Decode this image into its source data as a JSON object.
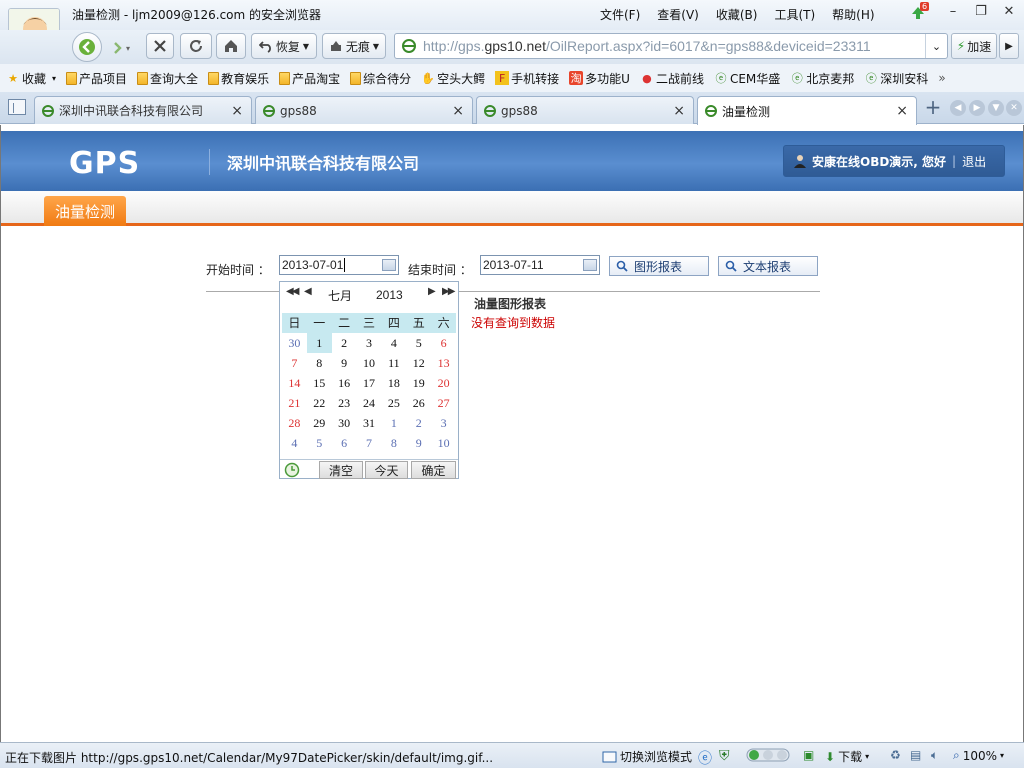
{
  "window": {
    "title": "油量检测 - ljm2009@126.com 的安全浏览器",
    "menus": [
      "文件(F)",
      "查看(V)",
      "收藏(B)",
      "工具(T)",
      "帮助(H)"
    ],
    "update_badge": "6"
  },
  "toolbar": {
    "restore_label": "恢复",
    "notrace_label": "无痕",
    "address_host": "http://gps.",
    "address_domain": "gps10.net",
    "address_path": "/OilReport.aspx?id=6017&n=gps88&deviceid=23311",
    "speedup_label": "加速"
  },
  "bookmarks": {
    "items": [
      "收藏",
      "产品项目",
      "查询大全",
      "教育娱乐",
      "产品淘宝",
      "综合待分",
      "空头大鳄",
      "手机转接",
      "多功能U",
      "二战前线",
      "CEM华盛",
      "北京麦邦",
      "深圳安科"
    ],
    "more": "»"
  },
  "tabs": [
    {
      "label": "深圳中讯联合科技有限公司"
    },
    {
      "label": "gps88"
    },
    {
      "label": "gps88"
    },
    {
      "label": "油量检测"
    }
  ],
  "site": {
    "logo": "GPS",
    "company": "深圳中讯联合科技有限公司",
    "user_greeting": "安康在线OBD演示, 您好",
    "logout": "退出",
    "nav_tab": "油量检测"
  },
  "form": {
    "start_label": "开始时间 ：",
    "start_value": "2013-07-01",
    "end_label": "结束时间 ：",
    "end_value": "2013-07-11",
    "graph_btn": "图形报表",
    "text_btn": "文本报表"
  },
  "report": {
    "title": "油量图形报表",
    "no_data": "没有查询到数据"
  },
  "datepicker": {
    "month": "七月",
    "year": "2013",
    "weekdays": [
      "日",
      "一",
      "二",
      "三",
      "四",
      "五",
      "六"
    ],
    "days": [
      "30",
      "1",
      "2",
      "3",
      "4",
      "5",
      "6",
      "7",
      "8",
      "9",
      "10",
      "11",
      "12",
      "13",
      "14",
      "15",
      "16",
      "17",
      "18",
      "19",
      "20",
      "21",
      "22",
      "23",
      "24",
      "25",
      "26",
      "27",
      "28",
      "29",
      "30",
      "31",
      "1",
      "2",
      "3",
      "4",
      "5",
      "6",
      "7",
      "8",
      "9",
      "10"
    ],
    "other_month_indices": [
      0,
      32,
      33,
      34,
      35,
      36,
      37,
      38,
      39,
      40,
      41
    ],
    "selected_index": 1,
    "clear_btn": "清空",
    "today_btn": "今天",
    "ok_btn": "确定"
  },
  "statusbar": {
    "text": "正在下载图片 http://gps.gps10.net/Calendar/My97DatePicker/skin/default/img.gif...",
    "mode_switch": "切换浏览模式",
    "download": "下载",
    "zoom": "100%"
  },
  "colors": {
    "header_blue": "#3c71b5",
    "orange_accent": "#e6661a",
    "weekend_red": "#d33",
    "no_data_red": "#c00"
  }
}
